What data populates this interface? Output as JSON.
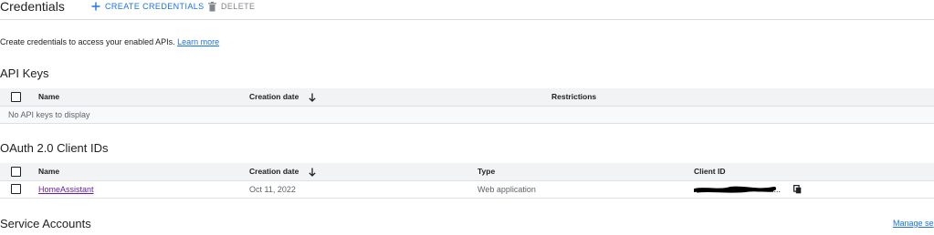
{
  "toolbar": {
    "title": "Credentials",
    "create_label": "CREATE CREDENTIALS",
    "delete_label": "DELETE"
  },
  "intro": {
    "text": "Create credentials to access your enabled APIs.",
    "link": "Learn more"
  },
  "api_keys": {
    "title": "API Keys",
    "columns": [
      "Name",
      "Creation date",
      "Restrictions"
    ],
    "empty_text": "No API keys to display"
  },
  "oauth": {
    "title": "OAuth 2.0 Client IDs",
    "columns": [
      "Name",
      "Creation date",
      "Type",
      "Client ID"
    ],
    "rows": [
      {
        "name": "HomeAssistant",
        "creation_date": "Oct 11, 2022",
        "type": "Web application",
        "client_id_suffix": "...."
      }
    ]
  },
  "service_accounts": {
    "title": "Service Accounts",
    "manage_label": "Manage se"
  },
  "colors": {
    "accent": "#1a73e8",
    "visited_link": "#681da8",
    "header_bg": "#f1f3f4",
    "muted": "#80868b"
  },
  "icons": [
    "plus-icon",
    "trash-icon",
    "sort-arrow-down-icon",
    "checkbox-icon",
    "copy-icon"
  ]
}
